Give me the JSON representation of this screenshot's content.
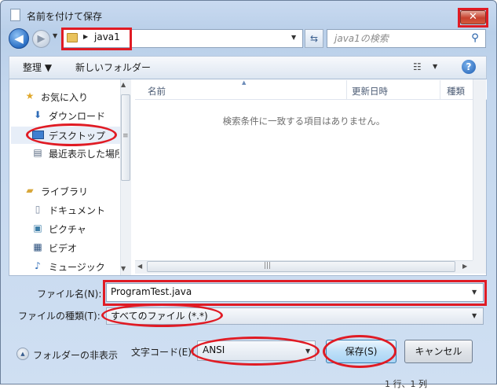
{
  "window": {
    "title": "名前を付けて保存",
    "close_label": "✕"
  },
  "address": {
    "back_label": "◀",
    "forward_label": "▶",
    "path_segment": "java1",
    "search_placeholder": "java1の検索"
  },
  "toolbar": {
    "organize_label": "整理 ▼",
    "new_folder_label": "新しいフォルダー",
    "help_label": "?"
  },
  "nav": {
    "favorites": {
      "label": "お気に入り"
    },
    "downloads": {
      "label": "ダウンロード"
    },
    "desktop": {
      "label": "デスクトップ"
    },
    "recent": {
      "label": "最近表示した場所"
    },
    "libraries": {
      "label": "ライブラリ"
    },
    "documents": {
      "label": "ドキュメント"
    },
    "pictures": {
      "label": "ピクチャ"
    },
    "videos": {
      "label": "ビデオ"
    },
    "music": {
      "label": "ミュージック"
    }
  },
  "list": {
    "columns": [
      "名前",
      "更新日時",
      "種類"
    ],
    "empty_message": "検索条件に一致する項目はありません。"
  },
  "form": {
    "filename_label": "ファイル名(N):",
    "filename_value": "ProgramTest.java",
    "filetype_label": "ファイルの種類(T):",
    "filetype_value": "すべてのファイル (*.*)",
    "hide_folders_label": "フォルダーの非表示",
    "encoding_label": "文字コード(E):",
    "encoding_value": "ANSI",
    "save_label": "保存(S)",
    "cancel_label": "キャンセル"
  },
  "status": {
    "text": "1 行、1 列"
  },
  "annotation_color": "#e01b24"
}
